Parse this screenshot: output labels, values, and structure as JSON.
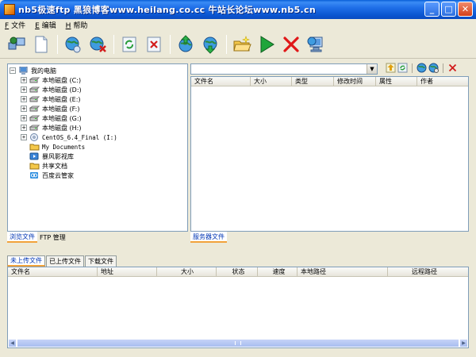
{
  "window": {
    "title": "nb5极速ftp   黑狼博客www.heilang.co.cc   牛站长论坛www.nb5.cn",
    "minimize_glyph": "_",
    "maximize_glyph": "□",
    "close_glyph": "✕"
  },
  "menu": [
    {
      "key": "F",
      "label": "文件"
    },
    {
      "key": "E",
      "label": "编辑"
    },
    {
      "key": "H",
      "label": "帮助"
    }
  ],
  "toolbar": {
    "icons": [
      "connect-icon",
      "new-document-icon",
      "globe-refresh-icon",
      "globe-disconnect-icon",
      "refresh-icon",
      "delete-icon",
      "upload-globe-icon",
      "download-globe-icon",
      "open-folder-icon",
      "play-icon",
      "stop-icon",
      "network-icon"
    ]
  },
  "local_tree": [
    {
      "label": "我的电脑",
      "level": 0,
      "expander": "−",
      "icon": "computer-icon"
    },
    {
      "label": "本地磁盘 (C:)",
      "level": 1,
      "expander": "+",
      "icon": "drive-icon"
    },
    {
      "label": "本地磁盘 (D:)",
      "level": 1,
      "expander": "+",
      "icon": "drive-icon"
    },
    {
      "label": "本地磁盘 (E:)",
      "level": 1,
      "expander": "+",
      "icon": "drive-icon"
    },
    {
      "label": "本地磁盘 (F:)",
      "level": 1,
      "expander": "+",
      "icon": "drive-icon"
    },
    {
      "label": "本地磁盘 (G:)",
      "level": 1,
      "expander": "+",
      "icon": "drive-icon"
    },
    {
      "label": "本地磁盘 (H:)",
      "level": 1,
      "expander": "+",
      "icon": "drive-icon"
    },
    {
      "label": "CentOS_6.4_Final (I:)",
      "level": 1,
      "expander": "+",
      "icon": "cd-icon"
    },
    {
      "label": "My Documents",
      "level": 1,
      "expander": "",
      "icon": "folder-icon"
    },
    {
      "label": "暴风影视库",
      "level": 1,
      "expander": "",
      "icon": "media-icon"
    },
    {
      "label": "共享文档",
      "level": 1,
      "expander": "",
      "icon": "folder-icon"
    },
    {
      "label": "百度云管家",
      "level": 1,
      "expander": "",
      "icon": "cloud-icon"
    }
  ],
  "left_tabs": [
    "浏览文件",
    "FTP 管理"
  ],
  "server_panel": {
    "path_value": "",
    "columns": [
      "文件名",
      "大小",
      "类型",
      "修改时间",
      "属性",
      "作者"
    ],
    "tab": "服务器文件"
  },
  "bottom_tabs": [
    "未上传文件",
    "已上传文件",
    "下载文件"
  ],
  "transfer_columns": [
    "文件名",
    "地址",
    "大小",
    "状态",
    "速度",
    "本地路径",
    "远程路径"
  ],
  "colors": {
    "titlebar": "#0b55d0",
    "accent_tab": "#f2a23b",
    "tab_text": "#0035b4"
  }
}
